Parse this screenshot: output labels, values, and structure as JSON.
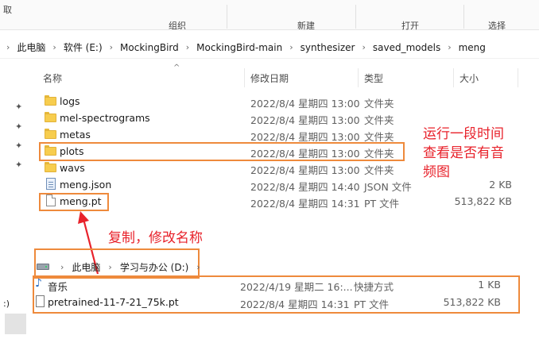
{
  "ribbon": {
    "crop_left": "取",
    "items": [
      "组织",
      "新建",
      "打开",
      "选择"
    ]
  },
  "breadcrumb": [
    "此电脑",
    "软件 (E:)",
    "MockingBird",
    "MockingBird-main",
    "synthesizer",
    "saved_models",
    "meng"
  ],
  "columns": {
    "name": "名称",
    "date": "修改日期",
    "type": "类型",
    "size": "大小"
  },
  "files": [
    {
      "name": "logs",
      "date": "2022/8/4 星期四 13:00",
      "type": "文件夹",
      "size": "",
      "icon": "folder-icon"
    },
    {
      "name": "mel-spectrograms",
      "date": "2022/8/4 星期四 13:00",
      "type": "文件夹",
      "size": "",
      "icon": "folder-icon"
    },
    {
      "name": "metas",
      "date": "2022/8/4 星期四 13:00",
      "type": "文件夹",
      "size": "",
      "icon": "folder-icon"
    },
    {
      "name": "plots",
      "date": "2022/8/4 星期四 13:00",
      "type": "文件夹",
      "size": "",
      "icon": "folder-icon"
    },
    {
      "name": "wavs",
      "date": "2022/8/4 星期四 13:00",
      "type": "文件夹",
      "size": "",
      "icon": "folder-icon"
    },
    {
      "name": "meng.json",
      "date": "2022/8/4 星期四 14:40",
      "type": "JSON 文件",
      "size": "2 KB",
      "icon": "json-file-icon"
    },
    {
      "name": "meng.pt",
      "date": "2022/8/4 星期四 14:31",
      "type": "PT 文件",
      "size": "513,822 KB",
      "icon": "file-icon"
    }
  ],
  "annotations": {
    "plots_note_line1": "运行一段时间",
    "plots_note_line2": "查看是否有音",
    "plots_note_line3": "频图",
    "copy_note": "复制，修改名称"
  },
  "left_fragment": ":)",
  "second_pane": {
    "breadcrumb": [
      "此电脑",
      "学习与办公 (D:)"
    ],
    "files": [
      {
        "name": "音乐",
        "date": "2022/4/19 星期二 16:...",
        "type": "快捷方式",
        "size": "1 KB",
        "icon": "music-shortcut-icon"
      },
      {
        "name": "pretrained-11-7-21_75k.pt",
        "date": "2022/8/4 星期四 14:31",
        "type": "PT 文件",
        "size": "513,822 KB",
        "icon": "file-icon"
      }
    ]
  },
  "colors": {
    "highlight": "#ee8a3c",
    "annotation": "#e8222b",
    "folder": "#f7cd4e"
  }
}
